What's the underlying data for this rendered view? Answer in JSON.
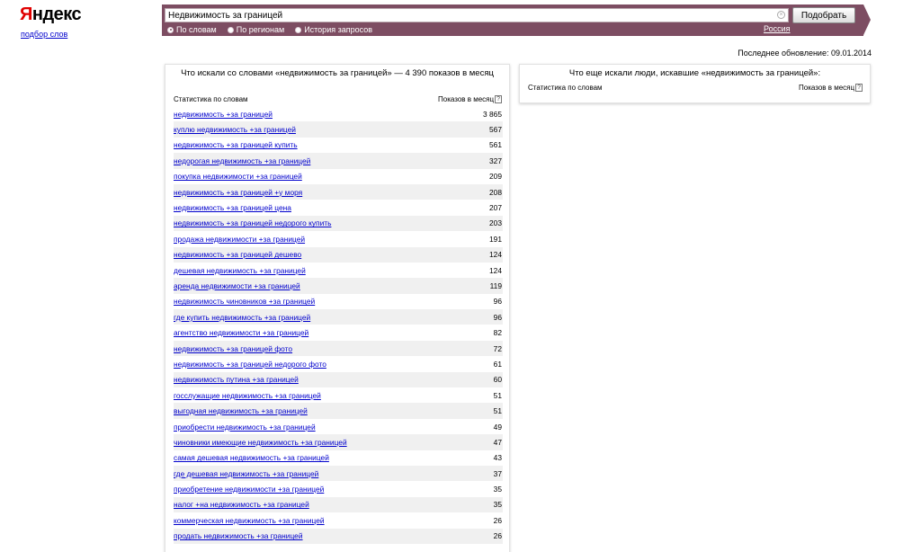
{
  "logo": {
    "first": "Я",
    "rest": "ндекс"
  },
  "subnav": "подбор слов",
  "search": {
    "value": "Недвижимость за границей",
    "button": "Подобрать",
    "clear": "×"
  },
  "modes": [
    "По словам",
    "По регионам",
    "История запросов"
  ],
  "region": "Россия",
  "last_update": "Последнее обновление: 09.01.2014",
  "left": {
    "title": "Что искали со словами «недвижимость за границей» — 4 390 показов в месяц",
    "col_query": "Статистика по словам",
    "col_count": "Показов в месяц",
    "help": "?",
    "rows": [
      {
        "q": "недвижимость +за границей",
        "n": "3 865"
      },
      {
        "q": "куплю недвижимость +за границей",
        "n": "567"
      },
      {
        "q": "недвижимость +за границей купить",
        "n": "561"
      },
      {
        "q": "недорогая недвижимость +за границей",
        "n": "327"
      },
      {
        "q": "покупка недвижимости +за границей",
        "n": "209"
      },
      {
        "q": "недвижимость +за границей +у моря",
        "n": "208"
      },
      {
        "q": "недвижимость +за границей цена",
        "n": "207"
      },
      {
        "q": "недвижимость +за границей недорого купить",
        "n": "203"
      },
      {
        "q": "продажа недвижимости +за границей",
        "n": "191"
      },
      {
        "q": "недвижимость +за границей дешево",
        "n": "124"
      },
      {
        "q": "дешевая недвижимость +за границей",
        "n": "124"
      },
      {
        "q": "аренда недвижимости +за границей",
        "n": "119"
      },
      {
        "q": "недвижимость чиновников +за границей",
        "n": "96"
      },
      {
        "q": "где купить недвижимость +за границей",
        "n": "96"
      },
      {
        "q": "агентство недвижимости +за границей",
        "n": "82"
      },
      {
        "q": "недвижимость +за границей фото",
        "n": "72"
      },
      {
        "q": "недвижимость +за границей недорого фото",
        "n": "61"
      },
      {
        "q": "недвижимость путина +за границей",
        "n": "60"
      },
      {
        "q": "госслужащие недвижимость +за границей",
        "n": "51"
      },
      {
        "q": "выгодная недвижимость +за границей",
        "n": "51"
      },
      {
        "q": "приобрести недвижимость +за границей",
        "n": "49"
      },
      {
        "q": "чиновники имеющие недвижимость +за границей",
        "n": "47"
      },
      {
        "q": "самая дешевая недвижимость +за границей",
        "n": "43"
      },
      {
        "q": "где дешевая недвижимость +за границей",
        "n": "37"
      },
      {
        "q": "приобретение недвижимости +за границей",
        "n": "35"
      },
      {
        "q": "налог +на недвижимость +за границей",
        "n": "35"
      },
      {
        "q": "коммерческая недвижимость +за границей",
        "n": "26"
      },
      {
        "q": "продать недвижимость +за границей",
        "n": "26"
      }
    ]
  },
  "right": {
    "title": "Что еще искали люди, искавшие «недвижимость за границей»:",
    "col_query": "Статистика по словам",
    "col_count": "Показов в месяц",
    "help": "?"
  },
  "colors": {
    "bar": "#7d4d62",
    "link": "#0000cc",
    "logo_red": "#e00000"
  }
}
